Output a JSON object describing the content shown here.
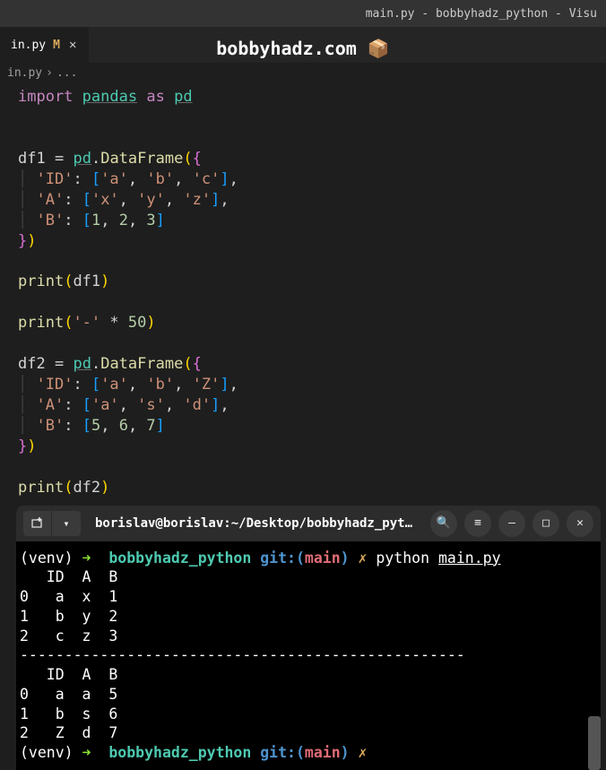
{
  "titleBar": "main.py - bobbyhadz_python - Visu",
  "tab": {
    "name": "in.py",
    "modified": "M"
  },
  "watermark": {
    "text": "bobbyhadz.com",
    "icon": "📦"
  },
  "breadcrumb": {
    "file": "in.py",
    "sep": "›",
    "more": "..."
  },
  "code": {
    "import": "import",
    "pandas": "pandas",
    "as": "as",
    "pd": "pd",
    "df1": "df1",
    "df2": "df2",
    "eq": "=",
    "dot": ".",
    "DataFrame": "DataFrame",
    "keys": {
      "id": "'ID'",
      "a": "'A'",
      "b": "'B'"
    },
    "df1_id": [
      "'a'",
      "'b'",
      "'c'"
    ],
    "df1_a": [
      "'x'",
      "'y'",
      "'z'"
    ],
    "df1_b": [
      "1",
      "2",
      "3"
    ],
    "df2_id": [
      "'a'",
      "'b'",
      "'Z'"
    ],
    "df2_a": [
      "'a'",
      "'s'",
      "'d'"
    ],
    "df2_b": [
      "5",
      "6",
      "7"
    ],
    "print": "print",
    "dash": "'-'",
    "star": "*",
    "fifty": "50"
  },
  "terminal": {
    "title": "borislav@borislav:~/Desktop/bobbyhadz_pyt...",
    "venv": "(venv)",
    "arrow": "➜",
    "dir": "bobbyhadz_python",
    "git": "git:(",
    "branch": "main",
    "gitclose": ")",
    "x": "✗",
    "cmd": "python",
    "file": "main.py",
    "output": {
      "hdr1": "   ID  A  B",
      "r0a": "0   a  x  1",
      "r1a": "1   b  y  2",
      "r2a": "2   c  z  3",
      "sep": "--------------------------------------------------",
      "hdr2": "   ID  A  B",
      "r0b": "0   a  a  5",
      "r1b": "1   b  s  6",
      "r2b": "2   Z  d  7"
    }
  }
}
